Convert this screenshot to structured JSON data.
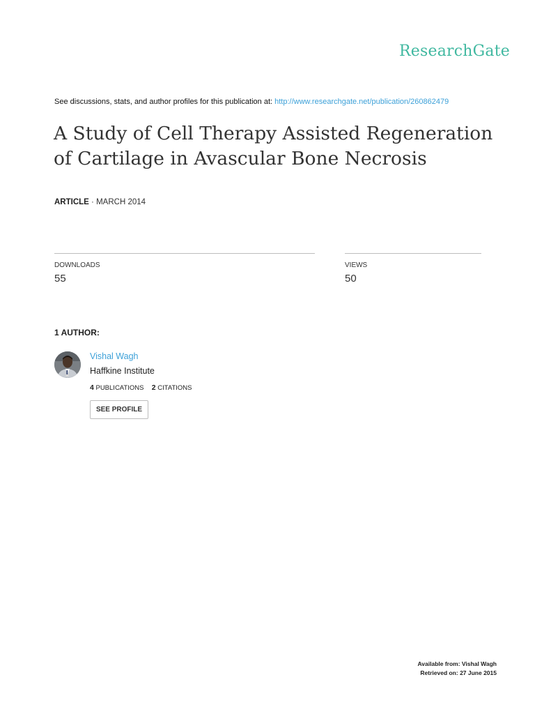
{
  "brand": {
    "name": "ResearchGate"
  },
  "discussion": {
    "prefix": "See discussions, stats, and author profiles for this publication at:",
    "url": "http://www.researchgate.net/publication/260862479"
  },
  "article": {
    "title": "A Study of Cell Therapy Assisted Regeneration of Cartilage in Avascular Bone Necrosis",
    "type": "ARTICLE",
    "separator": "·",
    "date": "MARCH 2014"
  },
  "stats": {
    "downloads_label": "DOWNLOADS",
    "downloads_value": "55",
    "views_label": "VIEWS",
    "views_value": "50"
  },
  "authors": {
    "heading": "1 AUTHOR:",
    "list": [
      {
        "name": "Vishal Wagh",
        "institution": "Haffkine Institute",
        "publications_count": "4",
        "publications_label": "PUBLICATIONS",
        "citations_count": "2",
        "citations_label": "CITATIONS",
        "profile_button": "SEE PROFILE"
      }
    ]
  },
  "footer": {
    "available_from": "Available from: Vishal Wagh",
    "retrieved_on": "Retrieved on: 27 June 2015"
  },
  "colors": {
    "brand": "#40b8a0",
    "link": "#3ca0d8"
  }
}
